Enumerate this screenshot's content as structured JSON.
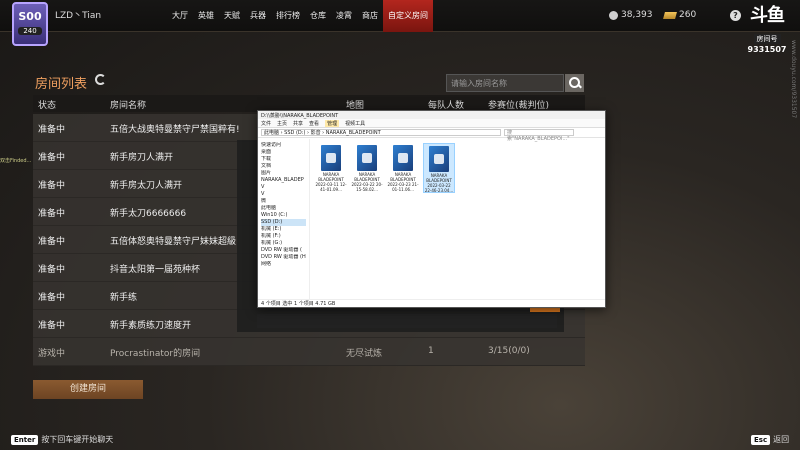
{
  "topbar": {
    "rank_badge": "S00",
    "rank_sub": "240",
    "player_name": "LZD丶Tian",
    "nav": [
      "大厅",
      "英雄",
      "天赋",
      "兵器",
      "排行榜",
      "仓库",
      "凌霄",
      "商店",
      "自定义房间"
    ],
    "active_nav": "自定义房间",
    "coins": "38,393",
    "gold": "260",
    "help": "?"
  },
  "douyu": {
    "logo": "斗鱼",
    "room_label": "房间号",
    "room_id": "9331507",
    "side_watermark": "www.douyu.com/9331507"
  },
  "room_list": {
    "title": "房间列表",
    "search_placeholder": "请输入房间名称",
    "headers": {
      "status": "状态",
      "name": "房间名称",
      "map": "地图",
      "players": "每队人数",
      "seat": "参赛位(裁判位)"
    },
    "rows": [
      {
        "status": "准备中",
        "name": "五倍大战奥特曼禁守尸禁国粹有!",
        "map": "",
        "players": "",
        "seat": ""
      },
      {
        "status": "准备中",
        "name": "新手房刀人满开",
        "map": "",
        "players": "",
        "seat": ""
      },
      {
        "status": "准备中",
        "name": "新手房太刀人满开",
        "map": "",
        "players": "",
        "seat": ""
      },
      {
        "status": "准备中",
        "name": "新手太刀6666666",
        "map": "",
        "players": "",
        "seat": ""
      },
      {
        "status": "准备中",
        "name": "五倍体怒奥特曼禁守尸妹妹超級",
        "map": "",
        "players": "",
        "seat": ""
      },
      {
        "status": "准备中",
        "name": "抖音太阳第一届苑种杯",
        "map": "",
        "players": "",
        "seat": ""
      },
      {
        "status": "准备中",
        "name": "新手练",
        "map": "",
        "players": "",
        "seat": ""
      },
      {
        "status": "准备中",
        "name": "新手素质练刀速度开",
        "map": "",
        "players": "",
        "seat": ""
      },
      {
        "status": "游戏中",
        "name": "Procrastinator的房间",
        "map": "无尽试炼",
        "players": "1",
        "seat": "3/15(0/0)"
      }
    ],
    "create_button": "创建房间"
  },
  "footer": {
    "enter_key": "Enter",
    "enter_text": "按下回车键开始聊天",
    "esc_key": "Esc",
    "esc_text": "返回"
  },
  "floating_tip": "双击Finded...",
  "explorer": {
    "title": "D:\\\\蒸胁\\\\NARAKA_BLADEPOINT",
    "tabs": [
      "文件",
      "主页",
      "共享",
      "查看",
      "管理"
    ],
    "manage_tab": "视频工具",
    "path": "此电脑 › SSD (D:) › 影音 › NARAKA_BLADEPOINT",
    "search_placeholder": "搜索\"NARAKA_BLADEPOI...\"",
    "nav": [
      "快速访问",
      "桌面",
      "下载",
      "文档",
      "图片",
      "NARAKA_BLADEP",
      "V",
      "V",
      "微",
      "此电脑",
      "Win10 (C:)",
      "SSD (D:)",
      "机械 (E:)",
      "机械 (F:)",
      "机械 (G:)",
      "DVD RW 驱动器 (",
      "DVD RW 驱动器 (H",
      "网络"
    ],
    "files": [
      {
        "name": "NARAKA BLADEPOINT 2022-03-11 12-41-01.09...",
        "selected": false
      },
      {
        "name": "NARAKA BLADEPOINT 2022-03-22 20-15-58.02...",
        "selected": false
      },
      {
        "name": "NARAKA BLADEPOINT 2022-03-23 21-01-11.06...",
        "selected": false
      },
      {
        "name": "NARAKA BLADEPOINT 2022-03-22 22-46-23.04...",
        "selected": true
      }
    ],
    "status": "4 个项目   选中 1 个项目 4.71 GB"
  }
}
